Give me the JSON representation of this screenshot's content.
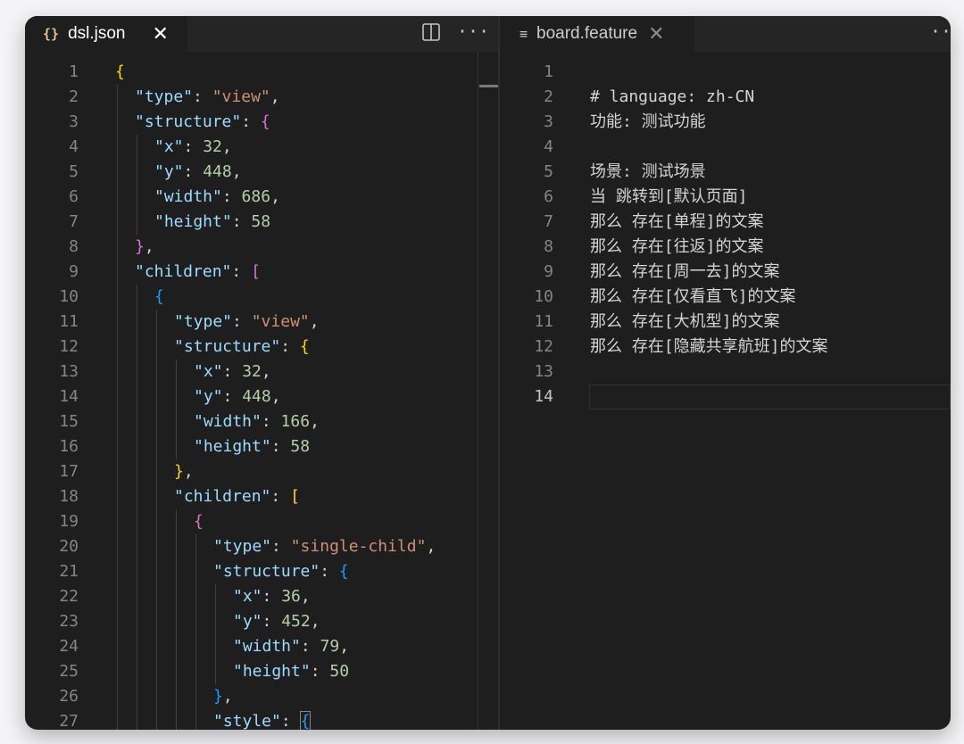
{
  "left_tab": {
    "icon": "{}",
    "title": "dsl.json",
    "close": "✕",
    "split_icon": "split-editor-icon",
    "more": "···"
  },
  "right_tab": {
    "icon": "≡",
    "title": "board.feature",
    "close": "✕",
    "more": "···"
  },
  "json_lines": [
    {
      "n": "1",
      "indent": 0,
      "tokens": [
        {
          "t": "{",
          "c": "b1"
        }
      ]
    },
    {
      "n": "2",
      "indent": 1,
      "tokens": [
        {
          "t": "\"type\"",
          "c": "k"
        },
        {
          "t": ": ",
          "c": "p"
        },
        {
          "t": "\"view\"",
          "c": "s"
        },
        {
          "t": ",",
          "c": "p"
        }
      ]
    },
    {
      "n": "3",
      "indent": 1,
      "tokens": [
        {
          "t": "\"structure\"",
          "c": "k"
        },
        {
          "t": ": ",
          "c": "p"
        },
        {
          "t": "{",
          "c": "b2"
        }
      ]
    },
    {
      "n": "4",
      "indent": 2,
      "tokens": [
        {
          "t": "\"x\"",
          "c": "k"
        },
        {
          "t": ": ",
          "c": "p"
        },
        {
          "t": "32",
          "c": "n"
        },
        {
          "t": ",",
          "c": "p"
        }
      ]
    },
    {
      "n": "5",
      "indent": 2,
      "tokens": [
        {
          "t": "\"y\"",
          "c": "k"
        },
        {
          "t": ": ",
          "c": "p"
        },
        {
          "t": "448",
          "c": "n"
        },
        {
          "t": ",",
          "c": "p"
        }
      ]
    },
    {
      "n": "6",
      "indent": 2,
      "tokens": [
        {
          "t": "\"width\"",
          "c": "k"
        },
        {
          "t": ": ",
          "c": "p"
        },
        {
          "t": "686",
          "c": "n"
        },
        {
          "t": ",",
          "c": "p"
        }
      ]
    },
    {
      "n": "7",
      "indent": 2,
      "tokens": [
        {
          "t": "\"height\"",
          "c": "k"
        },
        {
          "t": ": ",
          "c": "p"
        },
        {
          "t": "58",
          "c": "n"
        }
      ]
    },
    {
      "n": "8",
      "indent": 1,
      "tokens": [
        {
          "t": "}",
          "c": "b2"
        },
        {
          "t": ",",
          "c": "p"
        }
      ]
    },
    {
      "n": "9",
      "indent": 1,
      "tokens": [
        {
          "t": "\"children\"",
          "c": "k"
        },
        {
          "t": ": ",
          "c": "p"
        },
        {
          "t": "[",
          "c": "b2"
        }
      ]
    },
    {
      "n": "10",
      "indent": 2,
      "tokens": [
        {
          "t": "{",
          "c": "b3"
        }
      ]
    },
    {
      "n": "11",
      "indent": 3,
      "tokens": [
        {
          "t": "\"type\"",
          "c": "k"
        },
        {
          "t": ": ",
          "c": "p"
        },
        {
          "t": "\"view\"",
          "c": "s"
        },
        {
          "t": ",",
          "c": "p"
        }
      ]
    },
    {
      "n": "12",
      "indent": 3,
      "tokens": [
        {
          "t": "\"structure\"",
          "c": "k"
        },
        {
          "t": ": ",
          "c": "p"
        },
        {
          "t": "{",
          "c": "b1"
        }
      ]
    },
    {
      "n": "13",
      "indent": 4,
      "tokens": [
        {
          "t": "\"x\"",
          "c": "k"
        },
        {
          "t": ": ",
          "c": "p"
        },
        {
          "t": "32",
          "c": "n"
        },
        {
          "t": ",",
          "c": "p"
        }
      ]
    },
    {
      "n": "14",
      "indent": 4,
      "tokens": [
        {
          "t": "\"y\"",
          "c": "k"
        },
        {
          "t": ": ",
          "c": "p"
        },
        {
          "t": "448",
          "c": "n"
        },
        {
          "t": ",",
          "c": "p"
        }
      ]
    },
    {
      "n": "15",
      "indent": 4,
      "tokens": [
        {
          "t": "\"width\"",
          "c": "k"
        },
        {
          "t": ": ",
          "c": "p"
        },
        {
          "t": "166",
          "c": "n"
        },
        {
          "t": ",",
          "c": "p"
        }
      ]
    },
    {
      "n": "16",
      "indent": 4,
      "tokens": [
        {
          "t": "\"height\"",
          "c": "k"
        },
        {
          "t": ": ",
          "c": "p"
        },
        {
          "t": "58",
          "c": "n"
        }
      ]
    },
    {
      "n": "17",
      "indent": 3,
      "tokens": [
        {
          "t": "}",
          "c": "b1"
        },
        {
          "t": ",",
          "c": "p"
        }
      ]
    },
    {
      "n": "18",
      "indent": 3,
      "tokens": [
        {
          "t": "\"children\"",
          "c": "k"
        },
        {
          "t": ": ",
          "c": "p"
        },
        {
          "t": "[",
          "c": "b1"
        }
      ]
    },
    {
      "n": "19",
      "indent": 4,
      "tokens": [
        {
          "t": "{",
          "c": "b2"
        }
      ]
    },
    {
      "n": "20",
      "indent": 5,
      "tokens": [
        {
          "t": "\"type\"",
          "c": "k"
        },
        {
          "t": ": ",
          "c": "p"
        },
        {
          "t": "\"single-child\"",
          "c": "s"
        },
        {
          "t": ",",
          "c": "p"
        }
      ]
    },
    {
      "n": "21",
      "indent": 5,
      "tokens": [
        {
          "t": "\"structure\"",
          "c": "k"
        },
        {
          "t": ": ",
          "c": "p"
        },
        {
          "t": "{",
          "c": "b3"
        }
      ]
    },
    {
      "n": "22",
      "indent": 6,
      "tokens": [
        {
          "t": "\"x\"",
          "c": "k"
        },
        {
          "t": ": ",
          "c": "p"
        },
        {
          "t": "36",
          "c": "n"
        },
        {
          "t": ",",
          "c": "p"
        }
      ]
    },
    {
      "n": "23",
      "indent": 6,
      "tokens": [
        {
          "t": "\"y\"",
          "c": "k"
        },
        {
          "t": ": ",
          "c": "p"
        },
        {
          "t": "452",
          "c": "n"
        },
        {
          "t": ",",
          "c": "p"
        }
      ]
    },
    {
      "n": "24",
      "indent": 6,
      "tokens": [
        {
          "t": "\"width\"",
          "c": "k"
        },
        {
          "t": ": ",
          "c": "p"
        },
        {
          "t": "79",
          "c": "n"
        },
        {
          "t": ",",
          "c": "p"
        }
      ]
    },
    {
      "n": "25",
      "indent": 6,
      "tokens": [
        {
          "t": "\"height\"",
          "c": "k"
        },
        {
          "t": ": ",
          "c": "p"
        },
        {
          "t": "50",
          "c": "n"
        }
      ]
    },
    {
      "n": "26",
      "indent": 5,
      "tokens": [
        {
          "t": "}",
          "c": "b3"
        },
        {
          "t": ",",
          "c": "p"
        }
      ]
    },
    {
      "n": "27",
      "indent": 5,
      "tokens": [
        {
          "t": "\"style\"",
          "c": "k"
        },
        {
          "t": ": ",
          "c": "p"
        },
        {
          "t": "{",
          "c": "b3 bracket-hl"
        }
      ]
    }
  ],
  "feature_lines": [
    {
      "n": "1",
      "text": ""
    },
    {
      "n": "2",
      "text": "# language: zh-CN"
    },
    {
      "n": "3",
      "text": "功能: 测试功能"
    },
    {
      "n": "4",
      "text": ""
    },
    {
      "n": "5",
      "text": "场景: 测试场景"
    },
    {
      "n": "6",
      "text": "当 跳转到[默认页面]"
    },
    {
      "n": "7",
      "text": "那么 存在[单程]的文案"
    },
    {
      "n": "8",
      "text": "那么 存在[往返]的文案"
    },
    {
      "n": "9",
      "text": "那么 存在[周一去]的文案"
    },
    {
      "n": "10",
      "text": "那么 存在[仅看直飞]的文案"
    },
    {
      "n": "11",
      "text": "那么 存在[大机型]的文案"
    },
    {
      "n": "12",
      "text": "那么 存在[隐藏共享航班]的文案"
    },
    {
      "n": "13",
      "text": ""
    },
    {
      "n": "14",
      "text": "",
      "active": true
    }
  ]
}
